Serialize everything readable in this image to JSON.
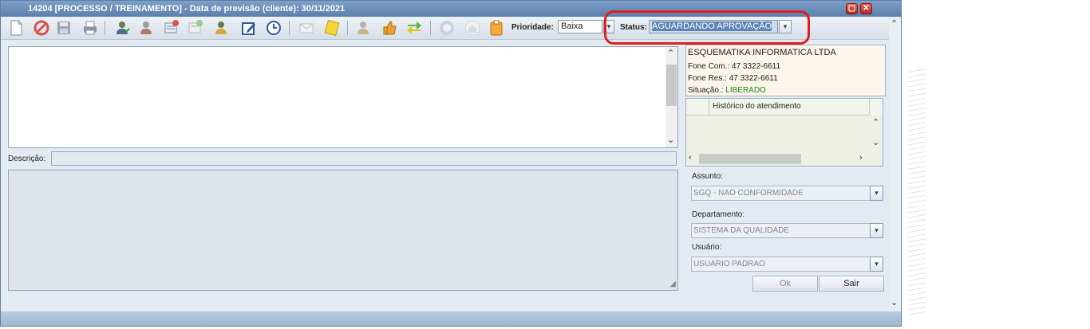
{
  "window": {
    "title": "14204 [PROCESSO / TREINAMENTO] - Data de previsão (cliente): 30/11/2021"
  },
  "toolbar": {
    "icons": [
      "new-document-icon",
      "cancel-icon",
      "save-icon",
      "print-icon",
      "user-check-icon",
      "user-remove-icon",
      "card-remove-icon",
      "card-add-icon",
      "user-edit-icon",
      "edit-icon",
      "clock-icon",
      "mail-icon",
      "note-icon",
      "user-lock-icon",
      "thumbs-up-icon",
      "transfer-arrows-icon",
      "twitter-icon",
      "home-icon",
      "clipboard-icon"
    ],
    "prioridade_label": "Prioridade:",
    "prioridade_value": "Baixa",
    "status_label": "Status:",
    "status_value": "AGUARDANDO APROVAÇÃO"
  },
  "form": {
    "descricao_label": "Descrição:"
  },
  "client": {
    "name": "ESQUEMATIKA INFORMATICA LTDA",
    "fone_com_label": "Fone Com.:",
    "fone_com": "47 3322-6611",
    "fone_res_label": "Fone Res.:",
    "fone_res": "47 3322-6611",
    "situacao_label": "Situação.:",
    "situacao": "LIBERADO"
  },
  "historico": {
    "header": "Histórico do atendimento"
  },
  "fields": {
    "assunto_label": "Assunto:",
    "assunto_value": "SGQ - NAO CONFORMIDADE",
    "departamento_label": "Departamento:",
    "departamento_value": "SISTEMA DA QUALIDADE",
    "usuario_label": "Usuário:",
    "usuario_value": "USUARIO PADRAO"
  },
  "buttons": {
    "ok": "Ok",
    "sair": "Sair"
  },
  "colors": {
    "accent": "#587fab",
    "highlight": "#e21d1d",
    "situacao": "#1a8a1a"
  }
}
